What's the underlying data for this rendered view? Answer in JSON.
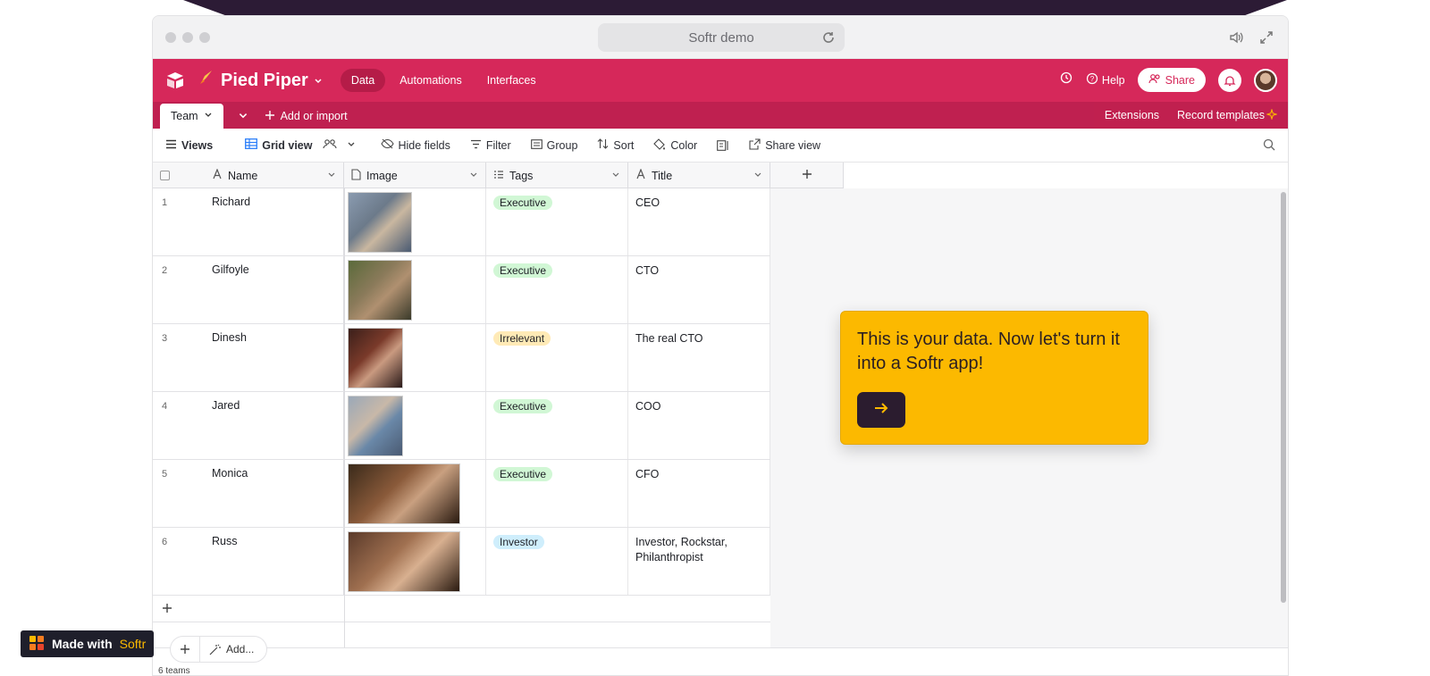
{
  "browser": {
    "title": "Softr demo"
  },
  "appbar": {
    "base_name": "Pied Piper",
    "nav": [
      {
        "label": "Data",
        "active": true
      },
      {
        "label": "Automations",
        "active": false
      },
      {
        "label": "Interfaces",
        "active": false
      }
    ],
    "help_label": "Help",
    "share_label": "Share",
    "accent_color": "#d6285a"
  },
  "tabbar": {
    "active_tab": "Team",
    "add_import_label": "Add or import",
    "extensions_label": "Extensions",
    "record_templates_label": "Record templates"
  },
  "toolbar": {
    "views_label": "Views",
    "grid_view_label": "Grid view",
    "hide_fields_label": "Hide fields",
    "filter_label": "Filter",
    "group_label": "Group",
    "sort_label": "Sort",
    "color_label": "Color",
    "share_view_label": "Share view"
  },
  "table": {
    "columns": [
      "Name",
      "Image",
      "Tags",
      "Title"
    ],
    "rows": [
      {
        "num": "1",
        "name": "Richard",
        "tag": "Executive",
        "tag_type": "executive",
        "title": "CEO"
      },
      {
        "num": "2",
        "name": "Gilfoyle",
        "tag": "Executive",
        "tag_type": "executive",
        "title": "CTO"
      },
      {
        "num": "3",
        "name": "Dinesh",
        "tag": "Irrelevant",
        "tag_type": "irrelevant",
        "title": "The real CTO"
      },
      {
        "num": "4",
        "name": "Jared",
        "tag": "Executive",
        "tag_type": "executive",
        "title": "COO"
      },
      {
        "num": "5",
        "name": "Monica",
        "tag": "Executive",
        "tag_type": "executive",
        "title": "CFO"
      },
      {
        "num": "6",
        "name": "Russ",
        "tag": "Investor",
        "tag_type": "investor",
        "title": "Investor, Rockstar, Philanthropist"
      }
    ],
    "tag_colors": {
      "executive": "#d1f7d5",
      "irrelevant": "#ffeab6",
      "investor": "#cfeefc"
    },
    "footer_count": "6 teams",
    "add_label": "Add..."
  },
  "callout": {
    "text": "This is your data. Now let's turn it into a Softr app!",
    "bg_color": "#fcb900"
  },
  "badge": {
    "made_with": "Made with",
    "brand": "Softr"
  }
}
